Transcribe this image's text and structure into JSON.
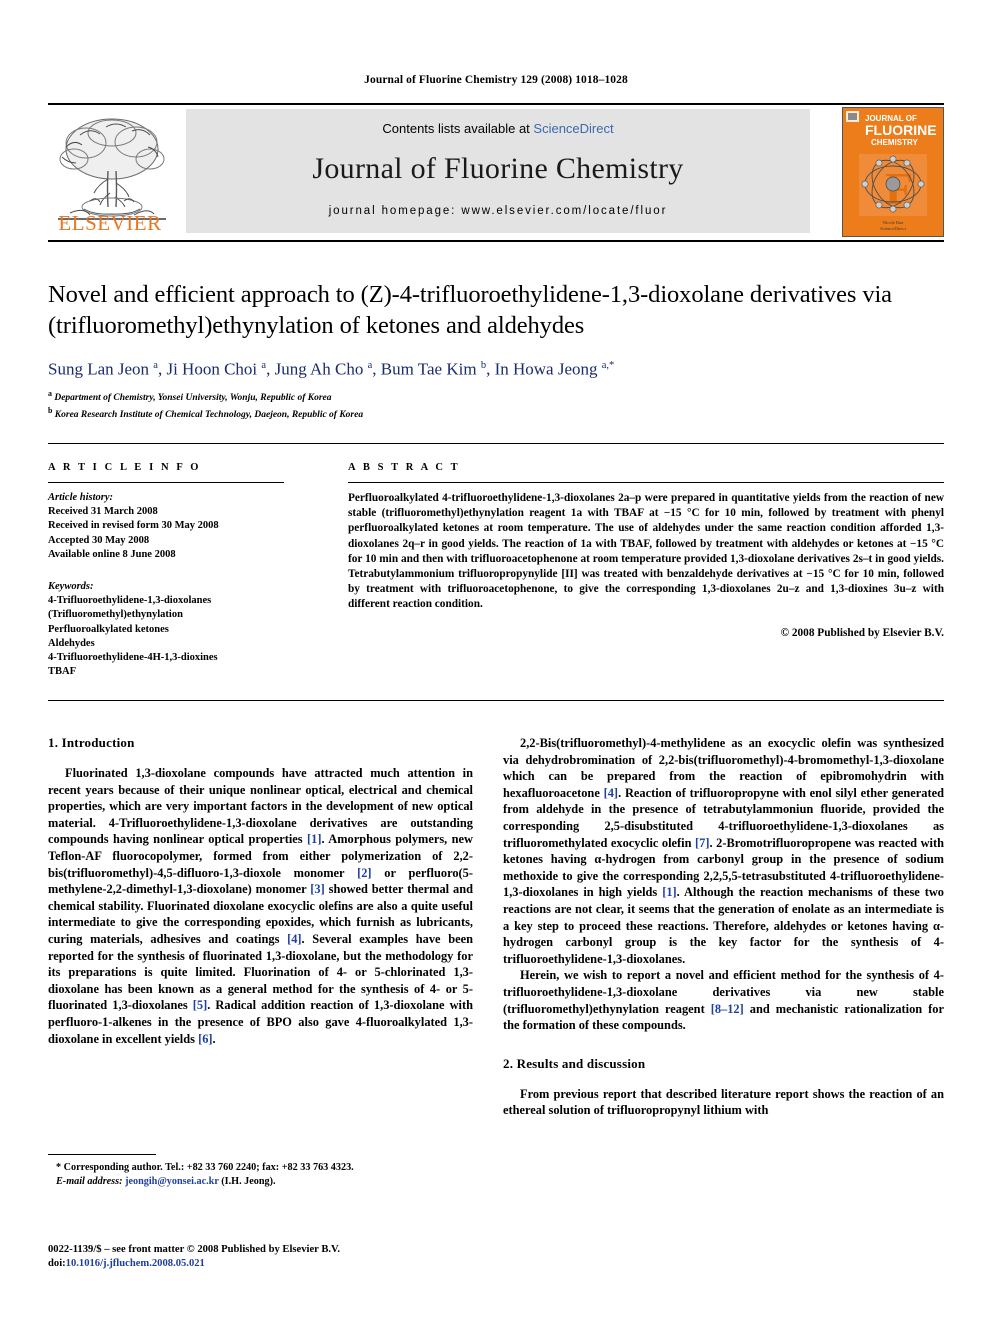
{
  "running_head": "Journal of Fluorine Chemistry 129 (2008) 1018–1028",
  "masthead": {
    "publisher_wordmark": "ELSEVIER",
    "contents_prefix": "Contents lists available at ",
    "contents_link": "ScienceDirect",
    "journal_title": "Journal of Fluorine Chemistry",
    "homepage_line": "journal homepage: www.elsevier.com/locate/fluor",
    "cover": {
      "line1": "JOURNAL OF",
      "line2": "FLUORINE",
      "line3": "CHEMISTRY",
      "footer1": "Nicole Ban",
      "footer2": "ScienceDirect",
      "bg_color": "#ED7D1A"
    }
  },
  "article": {
    "title": "Novel and efficient approach to (Z)-4-trifluoroethylidene-1,3-dioxolane derivatives via (trifluoromethyl)ethynylation of ketones and aldehydes",
    "authors_html": "Sung Lan Jeon <sup>a</sup>, Ji Hoon Choi <sup>a</sup>, Jung Ah Cho <sup>a</sup>, Bum Tae Kim <sup>b</sup>, In Howa Jeong <sup>a,</sup><sup>*</sup>",
    "affiliation_a": "Department of Chemistry, Yonsei University, Wonju, Republic of Korea",
    "affiliation_b": "Korea Research Institute of Chemical Technology, Daejeon, Republic of Korea"
  },
  "article_info": {
    "heading": "A R T I C L E  I N F O",
    "history_label": "Article history:",
    "history": [
      "Received 31 March 2008",
      "Received in revised form 30 May 2008",
      "Accepted 30 May 2008",
      "Available online 8 June 2008"
    ],
    "keywords_label": "Keywords:",
    "keywords": [
      "4-Trifluoroethylidene-1,3-dioxolanes",
      "(Trifluoromethyl)ethynylation",
      "Perfluoroalkylated ketones",
      "Aldehydes",
      "4-Trifluoroethylidene-4H-1,3-dioxines",
      "TBAF"
    ]
  },
  "abstract": {
    "heading": "A B S T R A C T",
    "text": "Perfluoroalkylated 4-trifluoroethylidene-1,3-dioxolanes 2a–p were prepared in quantitative yields from the reaction of new stable (trifluoromethyl)ethynylation reagent 1a with TBAF at −15 °C for 10 min, followed by treatment with phenyl perfluoroalkylated ketones at room temperature. The use of aldehydes under the same reaction condition afforded 1,3-dioxolanes 2q–r in good yields. The reaction of 1a with TBAF, followed by treatment with aldehydes or ketones at −15 °C for 10 min and then with trifluoroacetophenone at room temperature provided 1,3-dioxolane derivatives 2s–t in good yields. Tetrabutylammonium trifluoropropynylide [II] was treated with benzaldehyde derivatives at −15 °C for 10 min, followed by treatment with trifluoroacetophenone, to give the corresponding 1,3-dioxolanes 2u–z and 1,3-dioxines 3u–z with different reaction condition.",
    "copyright": "© 2008 Published by Elsevier B.V."
  },
  "sections": {
    "introduction_heading": "1. Introduction",
    "results_heading": "2. Results and discussion"
  },
  "body": {
    "left_p1_html": "Fluorinated 1,3-dioxolane compounds have attracted much attention in recent years because of their unique nonlinear optical, electrical and chemical properties, which are very important factors in the development of new optical material. 4-Trifluoroethylidene-1,3-dioxolane derivatives are outstanding compounds having nonlinear optical properties <span class=\"ref\">[1]</span>. Amorphous polymers, new Teflon-AF fluorocopolymer, formed from either polymerization of 2,2-bis(trifluoromethyl)-4,5-difluoro-1,3-dioxole monomer <span class=\"ref\">[2]</span> or perfluoro(5-methylene-2,2-dimethyl-1,3-dioxolane) monomer <span class=\"ref\">[3]</span> showed better thermal and chemical stability. Fluorinated dioxolane exocyclic olefins are also a quite useful intermediate to give the corresponding epoxides, which furnish as lubricants, curing materials, adhesives and coatings <span class=\"ref\">[4]</span>. Several examples have been reported for the synthesis of fluorinated 1,3-dioxolane, but the methodology for its preparations is quite limited. Fluorination of 4- or 5-chlorinated 1,3-dioxolane has been known as a general method for the synthesis of 4- or 5-fluorinated 1,3-dioxolanes <span class=\"ref\">[5]</span>. Radical addition reaction of 1,3-dioxolane with perfluoro-1-alkenes in the presence of BPO also gave 4-fluoroalkylated 1,3-dioxolane in excellent yields <span class=\"ref\">[6]</span>.",
    "right_p1_html": "2,2-Bis(trifluoromethyl)-4-methylidene as an exocyclic olefin was synthesized via dehydrobromination of 2,2-bis(trifluoromethyl)-4-bromomethyl-1,3-dioxolane which can be prepared from the reaction of epibromohydrin with hexafluoroacetone <span class=\"ref\">[4]</span>. Reaction of trifluoropropyne with enol silyl ether generated from aldehyde in the presence of tetrabutylammoniun fluoride, provided the corresponding 2,5-disubstituted 4-trifluoroethylidene-1,3-dioxolanes as trifluoromethylated exocyclic olefin <span class=\"ref\">[7]</span>. 2-Bromotrifluoropropene was reacted with ketones having α-hydrogen from carbonyl group in the presence of sodium methoxide to give the corresponding 2,2,5,5-tetrasubstituted 4-trifluoroethylidene-1,3-dioxolanes in high yields <span class=\"ref\">[1]</span>. Although the reaction mechanisms of these two reactions are not clear, it seems that the generation of enolate as an intermediate is a key step to proceed these reactions. Therefore, aldehydes or ketones having α-hydrogen carbonyl group is the key factor for the synthesis of 4-trifluoroethylidene-1,3-dioxolanes.",
    "right_p2_html": "Herein, we wish to report a novel and efficient method for the synthesis of 4-trifluoroethylidene-1,3-dioxolane derivatives via new stable (trifluoromethyl)ethynylation reagent <span class=\"ref\">[8–12]</span> and mechanistic rationalization for the formation of these compounds.",
    "right_p3_html": "From previous report that described literature report shows the reaction of an ethereal solution of trifluoropropynyl lithium with"
  },
  "footnote": {
    "corresponding_html": "* Corresponding author. Tel.: +82 33 760 2240; fax: +82 33 763 4323.",
    "email_html": "<span class=\"em\">E-mail address:</span> <span class=\"mail\">jeongih@yonsei.ac.kr</span> (I.H. Jeong)."
  },
  "footer": {
    "issn_line": "0022-1139/$ – see front matter © 2008 Published by Elsevier B.V.",
    "doi_prefix": "doi:",
    "doi": "10.1016/j.jfluchem.2008.05.021"
  }
}
